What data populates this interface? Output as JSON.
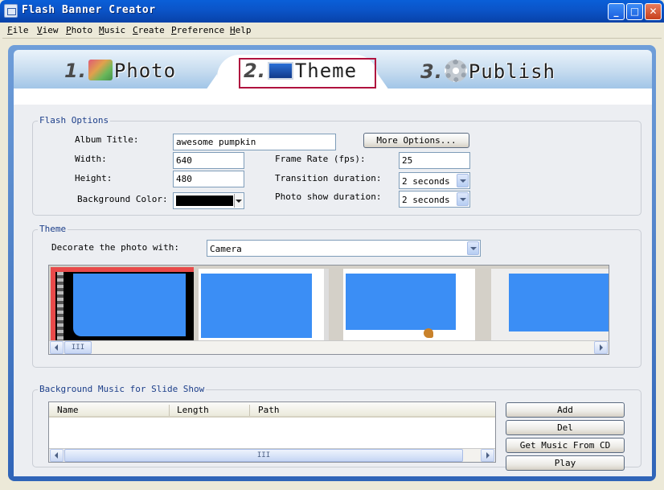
{
  "window": {
    "title": "Flash Banner Creator"
  },
  "menu": [
    "File",
    "View",
    "Photo",
    "Music",
    "Create",
    "Preference",
    "Help"
  ],
  "tabs": [
    {
      "num": "1.",
      "label": "Photo"
    },
    {
      "num": "2.",
      "label": "Theme"
    },
    {
      "num": "3.",
      "label": "Publish"
    }
  ],
  "flash_options": {
    "title": "Flash Options",
    "album_title_label": "Album Title:",
    "album_title_value": "awesome pumpkin",
    "more_options": "More Options...",
    "width_label": "Width:",
    "width_value": "640",
    "height_label": "Height:",
    "height_value": "480",
    "bg_color_label": "Background Color:",
    "bg_color_value": "#000000",
    "frame_rate_label": "Frame Rate (fps):",
    "frame_rate_value": "25",
    "transition_label": "Transition duration:",
    "transition_value": "2 seconds",
    "photo_show_label": "Photo show duration:",
    "photo_show_value": "2 seconds"
  },
  "theme": {
    "title": "Theme",
    "decorate_label": "Decorate the photo with:",
    "decorate_value": "Camera",
    "scroll_grip": "III"
  },
  "music": {
    "title": "Background Music for Slide Show",
    "columns": [
      "Name",
      "Length",
      "Path"
    ],
    "scroll_grip": "III",
    "buttons": {
      "add": "Add",
      "del": "Del",
      "get_cd": "Get Music From CD",
      "play": "Play"
    }
  },
  "colors": {
    "accent": "#0B54C8",
    "selected_thumb": "#E84A4A",
    "photo_blue": "#3B8EF5",
    "highlight": "#B0123E"
  }
}
